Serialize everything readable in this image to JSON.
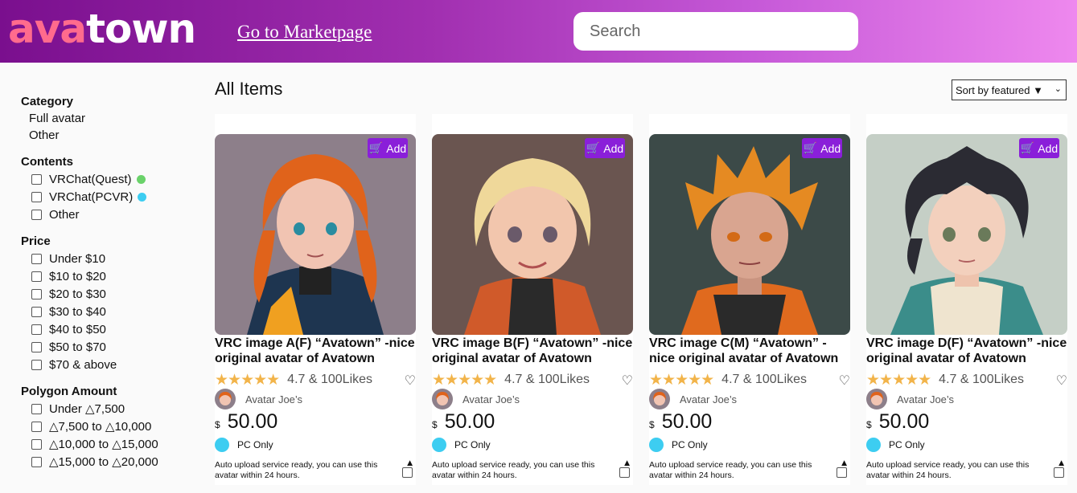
{
  "header": {
    "logo_ava": "ava",
    "logo_town": "town",
    "market_link": "Go to Marketpage",
    "search_placeholder": "Search"
  },
  "sidebar": {
    "category": {
      "title": "Category",
      "items": [
        "Full avatar",
        "Other"
      ]
    },
    "contents": {
      "title": "Contents",
      "items": [
        {
          "label": "VRChat(Quest)",
          "dot_color": "#6ad26a"
        },
        {
          "label": "VRChat(PCVR)",
          "dot_color": "#3dcdf1"
        },
        {
          "label": "Other"
        }
      ]
    },
    "price": {
      "title": "Price",
      "items": [
        "Under $10",
        "$10 to $20",
        "$20 to $30",
        "$30 to $40",
        "$40 to $50",
        "$50 to $70",
        "$70 & above"
      ]
    },
    "polygon": {
      "title": "Polygon Amount",
      "items": [
        "Under △7,500",
        "△7,500 to △10,000",
        "△10,000 to △15,000",
        "△15,000 to △20,000"
      ]
    }
  },
  "main": {
    "title": "All Items",
    "sort_label": "Sort by featured ▼"
  },
  "products": [
    {
      "title": "VRC image A(F) “Avatown” -nice original avatar of Avatown",
      "add_label": "Add",
      "stars": "★★★★★",
      "rating": "4.7 & 100Likes",
      "creator": "Avatar Joe’s",
      "currency": "$",
      "price": "50.00",
      "platform": "PC Only",
      "note": "Auto upload service ready, you can use this avatar within 24 hours.",
      "hair_color": "#e0631b"
    },
    {
      "title": "VRC image B(F) “Avatown” -nice original avatar of Avatown",
      "add_label": "Add",
      "stars": "★★★★★",
      "rating": "4.7 & 100Likes",
      "creator": "Avatar Joe’s",
      "currency": "$",
      "price": "50.00",
      "platform": "PC Only",
      "note": "Auto upload service ready, you can use this avatar within 24 hours.",
      "hair_color": "#efd89a"
    },
    {
      "title": "VRC image C(M) “Avatown” -nice original avatar of Avatown",
      "add_label": "Add",
      "stars": "★★★★★",
      "rating": "4.7 & 100Likes",
      "creator": "Avatar Joe’s",
      "currency": "$",
      "price": "50.00",
      "platform": "PC Only",
      "note": "Auto upload service ready, you can use this avatar within 24 hours.",
      "hair_color": "#e58a22"
    },
    {
      "title": "VRC image D(F) “Avatown” -nice original avatar of Avatown",
      "add_label": "Add",
      "stars": "★★★★★",
      "rating": "4.7 & 100Likes",
      "creator": "Avatar Joe’s",
      "currency": "$",
      "price": "50.00",
      "platform": "PC Only",
      "note": "Auto upload service ready, you can use this avatar within 24 hours.",
      "hair_color": "#2b2b33"
    }
  ]
}
